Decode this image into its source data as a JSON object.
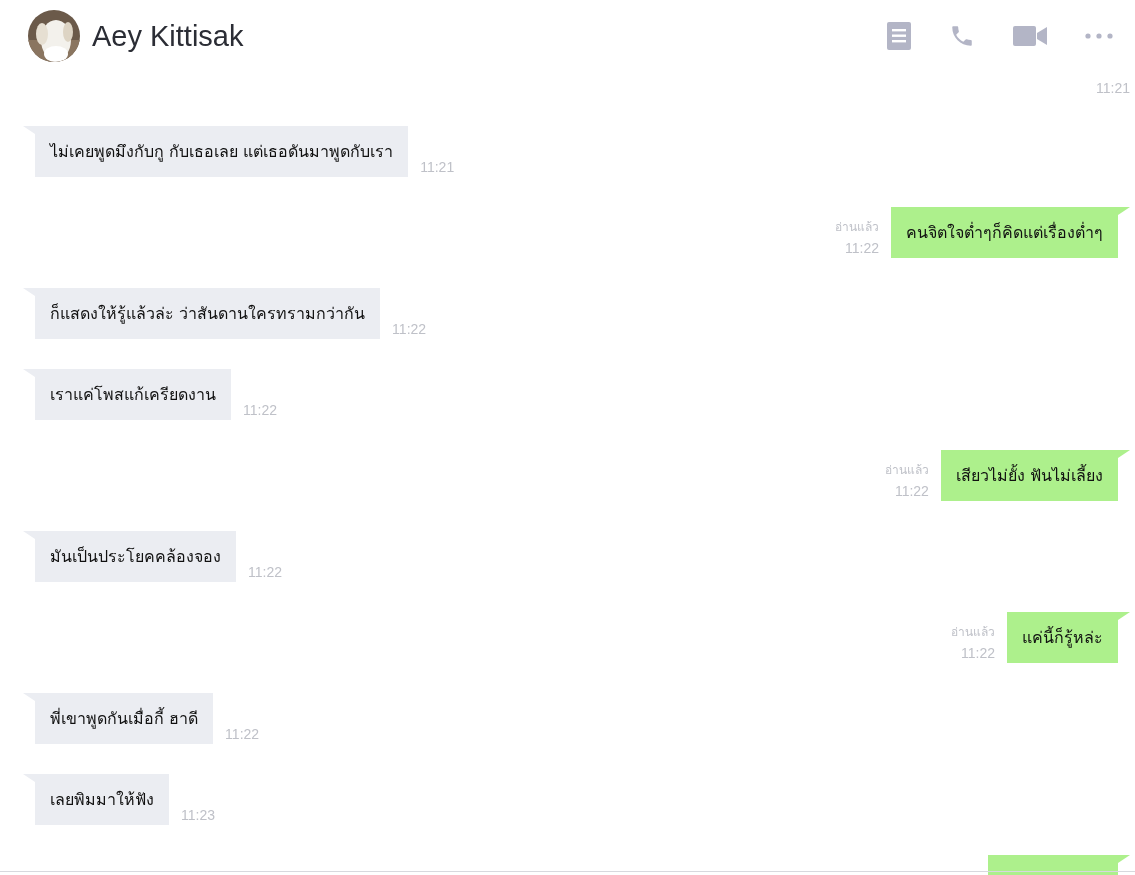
{
  "header": {
    "contact_name": "Aey Kittisak"
  },
  "messages": [
    {
      "kind": "cut_off_top",
      "time": "11:21"
    },
    {
      "kind": "incoming",
      "text": "ไม่เคยพูดมึงกับกู กับเธอเลย  แต่เธอดันมาพูดกับเรา",
      "time": "11:21"
    },
    {
      "kind": "outgoing",
      "text": "คนจิตใจต่ำๆก็คิดแต่เรื่องต่ำๆ",
      "read_label": "อ่านแล้ว",
      "time": "11:22"
    },
    {
      "kind": "incoming",
      "text": "ก็แสดงให้รู้แล้วล่ะ ว่าสันดานใครทรามกว่ากัน",
      "time": "11:22"
    },
    {
      "kind": "incoming",
      "text": "เราแค่โพสแก้เครียดงาน",
      "time": "11:22"
    },
    {
      "kind": "outgoing",
      "text": "เสียวไม่ยั้ง ฟันไม่เลี้ยง",
      "read_label": "อ่านแล้ว",
      "time": "11:22"
    },
    {
      "kind": "incoming",
      "text": "มันเป็นประโยคคล้องจอง",
      "time": "11:22"
    },
    {
      "kind": "outgoing",
      "text": "แค่นี้ก็รู้หล่ะ",
      "read_label": "อ่านแล้ว",
      "time": "11:22"
    },
    {
      "kind": "incoming",
      "text": "พี่เขาพูดกันเมื่อกี้ ฮาดี",
      "time": "11:22"
    },
    {
      "kind": "incoming",
      "text": "เลยพิมมาให้ฟัง",
      "time": "11:23"
    },
    {
      "kind": "cut_off_bottom"
    }
  ]
}
